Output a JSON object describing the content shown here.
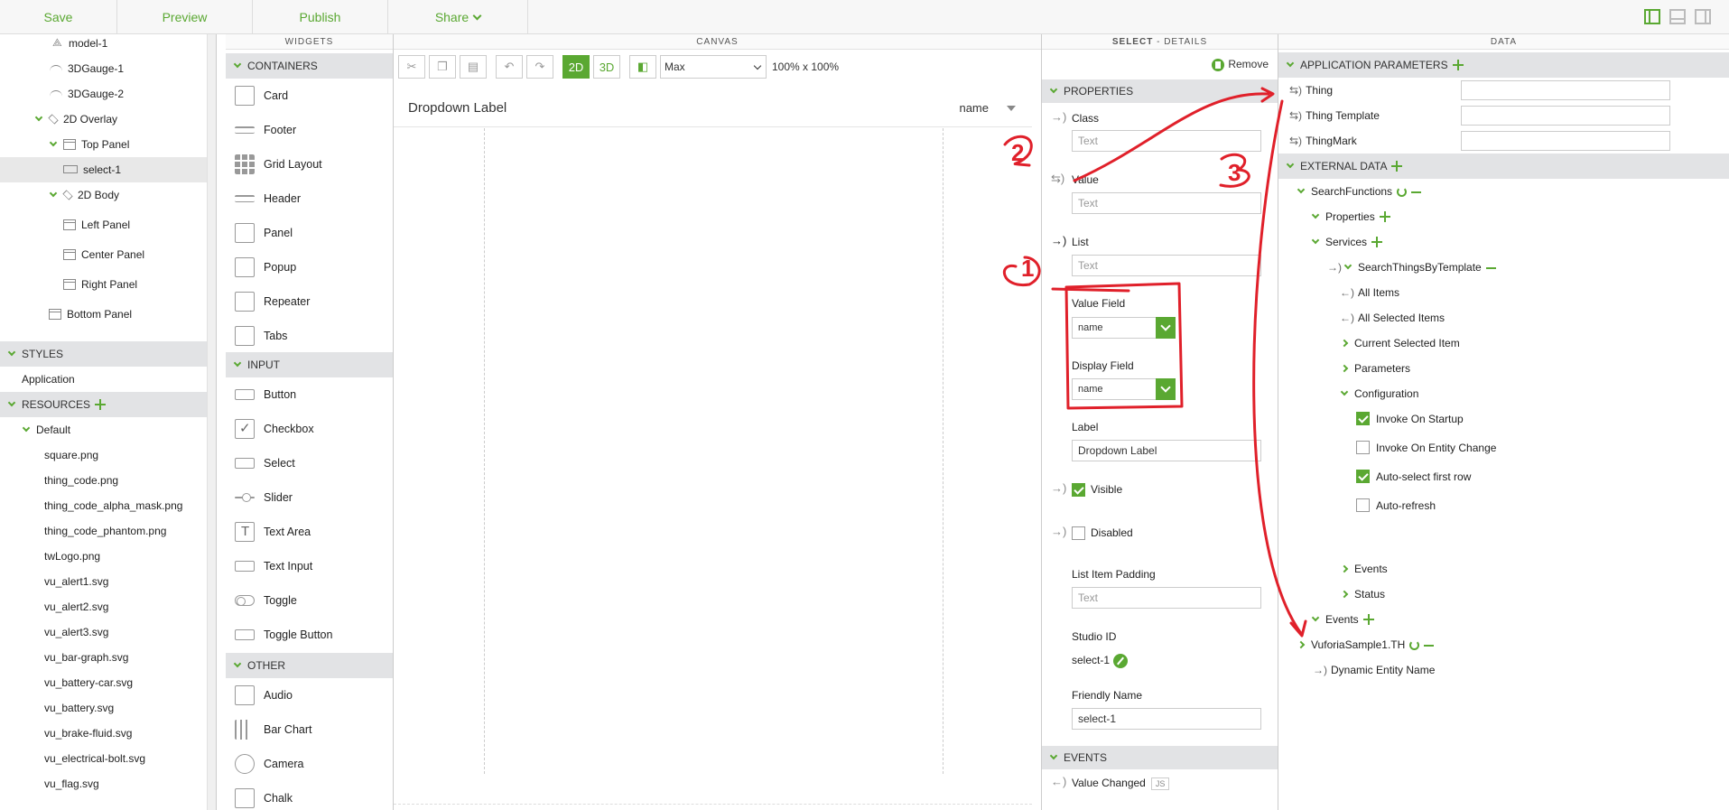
{
  "toolbar": {
    "save": "Save",
    "preview": "Preview",
    "publish": "Publish",
    "share": "Share"
  },
  "tree": {
    "items": [
      "model-1",
      "3DGauge-1",
      "3DGauge-2",
      "2D Overlay",
      "Top Panel",
      "select-1",
      "2D Body",
      "Left Panel",
      "Center Panel",
      "Right Panel",
      "Bottom Panel"
    ],
    "styles_header": "STYLES",
    "styles_item": "Application",
    "resources_header": "RESOURCES",
    "resources_folder": "Default",
    "resources": [
      "square.png",
      "thing_code.png",
      "thing_code_alpha_mask.png",
      "thing_code_phantom.png",
      "twLogo.png",
      "vu_alert1.svg",
      "vu_alert2.svg",
      "vu_alert3.svg",
      "vu_bar-graph.svg",
      "vu_battery-car.svg",
      "vu_battery.svg",
      "vu_brake-fluid.svg",
      "vu_electrical-bolt.svg",
      "vu_flag.svg"
    ]
  },
  "widgets": {
    "header": "WIDGETS",
    "containers_header": "CONTAINERS",
    "containers": [
      "Card",
      "Footer",
      "Grid Layout",
      "Header",
      "Panel",
      "Popup",
      "Repeater",
      "Tabs"
    ],
    "input_header": "INPUT",
    "input": [
      "Button",
      "Checkbox",
      "Select",
      "Slider",
      "Text Area",
      "Text Input",
      "Toggle",
      "Toggle Button"
    ],
    "other_header": "OTHER",
    "other": [
      "Audio",
      "Bar Chart",
      "Camera",
      "Chalk"
    ]
  },
  "canvas": {
    "header": "CANVAS",
    "mode_2d": "2D",
    "mode_3d": "3D",
    "size_select": "Max",
    "size_text": "100% x 100%",
    "dropdown_label": "Dropdown Label",
    "dropdown_value": "name"
  },
  "details": {
    "header_strong": "SELECT",
    "header_rest": " - DETAILS",
    "remove": "Remove",
    "properties_header": "PROPERTIES",
    "class_label": "Class",
    "class_placeholder": "Text",
    "value_label": "Value",
    "value_placeholder": "Text",
    "list_label": "List",
    "list_placeholder": "Text",
    "value_field_label": "Value Field",
    "value_field": "name",
    "display_field_label": "Display Field",
    "display_field": "name",
    "label_label": "Label",
    "label_value": "Dropdown Label",
    "visible_label": "Visible",
    "visible": true,
    "disabled_label": "Disabled",
    "disabled": false,
    "padding_label": "List Item Padding",
    "padding_placeholder": "Text",
    "studio_id_label": "Studio ID",
    "studio_id": "select-1",
    "friendly_label": "Friendly Name",
    "friendly_value": "select-1",
    "events_header": "EVENTS",
    "event_value_changed": "Value Changed",
    "js_badge": "JS"
  },
  "data": {
    "header": "DATA",
    "app_params_header": "APPLICATION PARAMETERS",
    "params": [
      "Thing",
      "Thing Template",
      "ThingMark"
    ],
    "external_header": "EXTERNAL DATA",
    "search_functions": "SearchFunctions",
    "properties": "Properties",
    "services": "Services",
    "service_name": "SearchThingsByTemplate",
    "all_items": "All Items",
    "all_selected": "All Selected Items",
    "current_selected": "Current Selected Item",
    "parameters": "Parameters",
    "configuration": "Configuration",
    "config": [
      {
        "label": "Invoke On Startup",
        "checked": true
      },
      {
        "label": "Invoke On Entity Change",
        "checked": false
      },
      {
        "label": "Auto-select first row",
        "checked": true
      },
      {
        "label": "Auto-refresh",
        "checked": false
      }
    ],
    "events": "Events",
    "status": "Status",
    "events2": "Events",
    "vuforia": "VuforiaSample1.TH",
    "dynamic_entity": "Dynamic Entity Name"
  },
  "annotations": [
    "1",
    "2",
    "3"
  ],
  "colors": {
    "accent": "#5aa832",
    "annotation": "#e0202a"
  }
}
